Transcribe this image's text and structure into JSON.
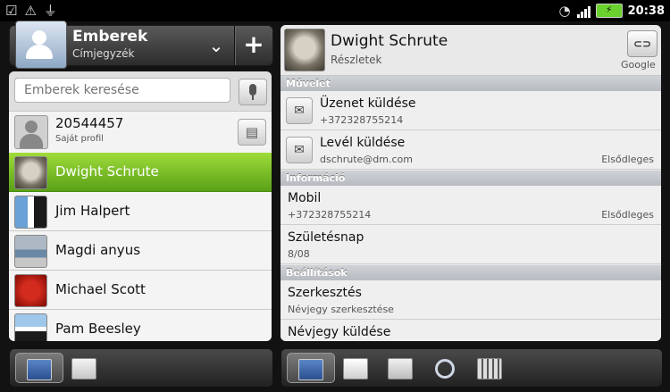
{
  "statusbar": {
    "time": "20:38"
  },
  "left_header": {
    "title": "Emberek",
    "subtitle": "Címjegyzék",
    "chevron": "⌄",
    "plus": "+"
  },
  "search": {
    "placeholder": "Emberek keresése"
  },
  "my_profile": {
    "number": "20544457",
    "label": "Saját profil"
  },
  "contacts": [
    {
      "name": "Dwight Schrute",
      "selected": true
    },
    {
      "name": "Jim Halpert"
    },
    {
      "name": "Magdi anyus"
    },
    {
      "name": "Michael Scott"
    },
    {
      "name": "Pam Beesley"
    }
  ],
  "detail": {
    "name": "Dwight Schrute",
    "subtitle": "Részletek",
    "link_label": "⊂⊃",
    "account": "Google",
    "sections": {
      "actions": "Művelet",
      "info": "Információ",
      "settings": "Beállítások"
    },
    "rows": {
      "message": {
        "title": "Üzenet küldése",
        "sub": "+372328755214"
      },
      "email": {
        "title": "Levél küldése",
        "sub": "dschrute@dm.com",
        "right": "Elsődleges"
      },
      "mobile": {
        "title": "Mobil",
        "sub": "+372328755214",
        "right": "Elsődleges"
      },
      "birthday": {
        "title": "Születésnap",
        "sub": "8/08"
      },
      "edit": {
        "title": "Szerkesztés",
        "sub": "Névjegy szerkesztése"
      },
      "send_card": {
        "title": "Névjegy küldése"
      }
    }
  }
}
